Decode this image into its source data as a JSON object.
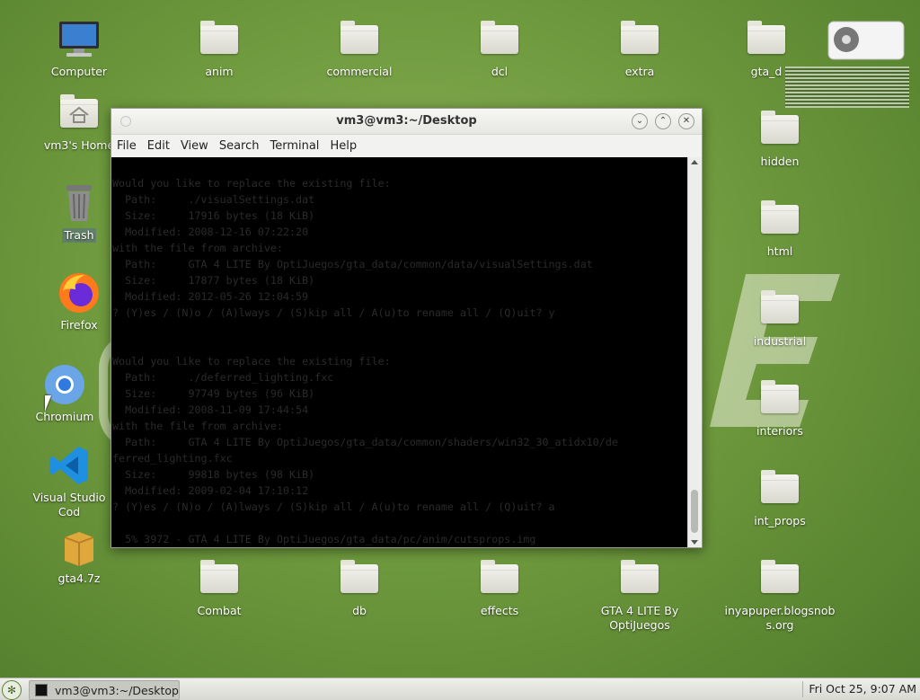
{
  "desktop": {
    "left_icons": [
      {
        "label": "Computer",
        "icon": "computer-icon"
      },
      {
        "label": "vm3's Home",
        "icon": "home-folder-icon"
      },
      {
        "label": "Trash",
        "icon": "trash-icon"
      },
      {
        "label": "Firefox",
        "icon": "firefox-icon"
      },
      {
        "label": "Chromium",
        "icon": "chromium-icon"
      },
      {
        "label": "Visual Studio Cod",
        "icon": "vscode-icon"
      },
      {
        "label": "gta4.7z",
        "icon": "archive-icon"
      }
    ],
    "top_folders": [
      "anim",
      "commercial",
      "dcl",
      "extra",
      "gta_d"
    ],
    "right_folders": [
      "hidden",
      "html",
      "industrial",
      "interiors",
      "int_props"
    ],
    "bottom_folders": [
      "Combat",
      "db",
      "effects",
      "GTA 4 LITE By OptiJuegos",
      "inyapuper.blogsnobs.org"
    ]
  },
  "terminal": {
    "title": "vm3@vm3:~/Desktop",
    "menu": [
      "File",
      "Edit",
      "View",
      "Search",
      "Terminal",
      "Help"
    ],
    "lines": [
      "Would you like to replace the existing file:",
      "  Path:     ./visualSettings.dat",
      "  Size:     17916 bytes (18 KiB)",
      "  Modified: 2008-12-16 07:22:20",
      "with the file from archive:",
      "  Path:     GTA 4 LITE By OptiJuegos/gta_data/common/data/visualSettings.dat",
      "  Size:     17877 bytes (18 KiB)",
      "  Modified: 2012-05-26 12:04:59",
      "? (Y)es / (N)o / (A)lways / (S)kip all / A(u)to rename all / (Q)uit? y",
      "",
      "",
      "Would you like to replace the existing file:",
      "  Path:     ./deferred_lighting.fxc",
      "  Size:     97749 bytes (96 KiB)",
      "  Modified: 2008-11-09 17:44:54",
      "with the file from archive:",
      "  Path:     GTA 4 LITE By OptiJuegos/gta_data/common/shaders/win32_30_atidx10/de",
      "ferred_lighting.fxc",
      "  Size:     99818 bytes (98 KiB)",
      "  Modified: 2009-02-04 17:10:12",
      "? (Y)es / (N)o / (A)lways / (S)kip all / A(u)to rename all / (Q)uit? a",
      "",
      "  5% 3972 - GTA 4 LITE By OptiJuegos/gta_data/pc/anim/cutsprops.img"
    ]
  },
  "taskbar": {
    "task_label": "vm3@vm3:~/Desktop",
    "clock": "Fri Oct 25,  9:07 AM"
  },
  "colors": {
    "accent": "#6f9a3e",
    "terminal_bg": "#000000"
  }
}
